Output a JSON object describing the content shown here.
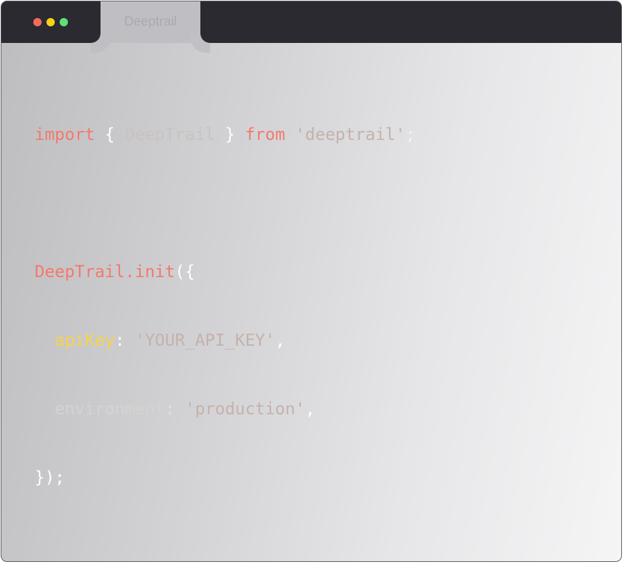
{
  "window": {
    "tab_title": "Deeptrail",
    "traffic_lights": [
      {
        "name": "close",
        "color": "#f26b5b"
      },
      {
        "name": "minimize",
        "color": "#f5d316"
      },
      {
        "name": "maximize",
        "color": "#5fe07a"
      }
    ]
  },
  "colors": {
    "keyword": "#f27a6b",
    "identifier_faded": "#c9c3c1",
    "punct": "#ffffff",
    "string": "#c4b2ab",
    "property_highlight": "#f5d34a",
    "property_faded": "#d6d2d0"
  },
  "code": {
    "line1": {
      "kw_import": "import",
      "brace_open": " { ",
      "ident": "DeepTrail",
      "brace_close": " } ",
      "kw_from": "from",
      "space": " ",
      "str": "'deeptrail'",
      "semi": ";"
    },
    "line2": {
      "call": "DeepTrail.init",
      "open": "({"
    },
    "line3": {
      "indent": "  ",
      "key": "apiKey",
      "colon": ": ",
      "str": "'YOUR_API_KEY'",
      "comma": ","
    },
    "line4": {
      "indent": "  ",
      "key": "environment",
      "colon": ": ",
      "str": "'production'",
      "comma": ","
    },
    "line5": {
      "close": "});"
    }
  }
}
